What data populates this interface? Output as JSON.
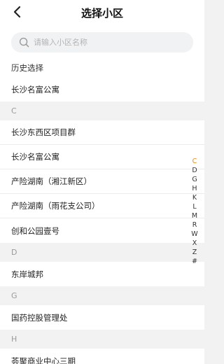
{
  "header": {
    "title": "选择小区",
    "back_icon": "chevron-left-icon"
  },
  "search": {
    "placeholder": "请输入小区名称",
    "value": "",
    "icon": "search-icon"
  },
  "history": {
    "title": "历史选择",
    "items": [
      "长沙名富公寓"
    ]
  },
  "groups": [
    {
      "letter": "C",
      "items": [
        "长沙东西区项目群",
        "长沙名富公寓",
        "产险湖南（湘江新区）",
        "产险湖南（雨花支公司）",
        "创和公园壹号"
      ]
    },
    {
      "letter": "D",
      "items": [
        "东岸城邦"
      ]
    },
    {
      "letter": "G",
      "items": [
        "国药控股管理处"
      ]
    },
    {
      "letter": "H",
      "items": [
        "荟聚商业中心三期"
      ]
    }
  ],
  "index_bar": {
    "letters": [
      "C",
      "D",
      "G",
      "H",
      "K",
      "L",
      "M",
      "R",
      "W",
      "X",
      "Z",
      "#"
    ],
    "active": "C",
    "active_color": "#f28a13"
  }
}
